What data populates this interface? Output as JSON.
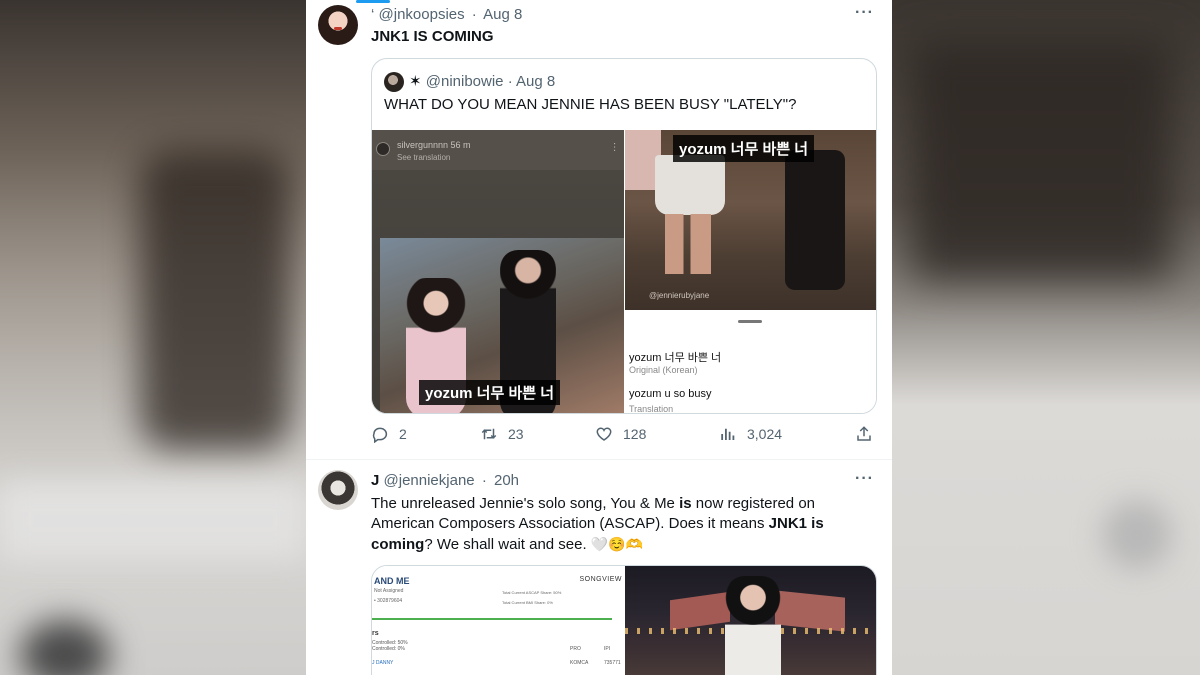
{
  "tweet1": {
    "name_glyph": "‘",
    "handle": "@jnkoopsies",
    "date": "Aug 8",
    "text": "JNK1 IS COMING",
    "more": "···",
    "quote": {
      "name_glyph": "✶",
      "handle": "@ninibowie",
      "date": "Aug 8",
      "text": "WHAT DO YOU MEAN JENNIE HAS BEEN BUSY \"LATELY\"?",
      "left_media": {
        "ig_user": "silvergunnnn  56 m",
        "ig_translation": "See translation",
        "caption": "yozum 너무 바쁜 너"
      },
      "right_media": {
        "caption": "yozum 너무 바쁜 너",
        "credit": "@jennierubyjane",
        "original_text": "yozum 너무 바쁜 너",
        "original_label": "Original (Korean)",
        "translated_text": "yozum u so busy",
        "translated_label": "Translation"
      }
    },
    "actions": {
      "replies": "2",
      "retweets": "23",
      "likes": "128",
      "views": "3,024"
    }
  },
  "tweet2": {
    "name": "J",
    "handle": "@jenniekjane",
    "date": "20h",
    "more": "···",
    "text_parts": {
      "p1": "The unreleased Jennie's solo song, You & Me ",
      "b1": "is",
      "p2": " now registered on American Composers Association (ASCAP). Does it means ",
      "b2": "JNK1 is coming",
      "p3": "? We shall wait and see. ",
      "emoji": "🤍☺️🫶"
    },
    "doc": {
      "title": "AND ME",
      "sub1": "Not Assigned",
      "sub2": "• 302879604",
      "brand": "SONGVIEW",
      "r1": "Total Current ASCAP Share: 50%",
      "r2": "Total Current BMI Share: 0%",
      "section": "rs",
      "row_a": "Controlled: 50%",
      "row_b": "Controlled: 0%",
      "col_pro": "PRO",
      "col_ipi": "IPI",
      "row1_name": "J DANNY",
      "row1_pro": "KOMCA",
      "row1_ipi": "735771"
    }
  },
  "colors": {
    "accent": "#1d9bf0",
    "secondary_text": "#536471",
    "border": "#cfd9de"
  }
}
